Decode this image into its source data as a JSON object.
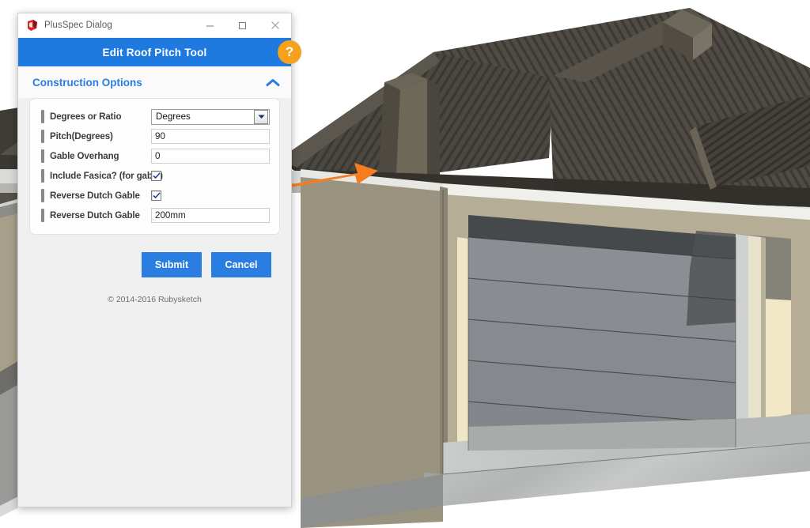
{
  "window": {
    "title": "PlusSpec Dialog",
    "app_icon": "sketchup-logo-icon",
    "controls": [
      {
        "name": "minimize-button",
        "glyph": "minimize-icon"
      },
      {
        "name": "maximize-button",
        "glyph": "maximize-icon"
      },
      {
        "name": "close-button",
        "glyph": "close-icon"
      }
    ]
  },
  "header": {
    "title": "Edit Roof Pitch Tool",
    "help_label": "?",
    "background_color": "#1f7ae0",
    "help_color": "#f5a11b"
  },
  "section": {
    "title": "Construction Options",
    "collapse_icon": "chevron-up-icon",
    "accent_color": "#2a7de1"
  },
  "form": {
    "fields": [
      {
        "label": "Degrees or Ratio",
        "type": "select",
        "value": "Degrees"
      },
      {
        "label": "Pitch(Degrees)",
        "type": "text",
        "value": "90"
      },
      {
        "label": "Gable Overhang",
        "type": "text",
        "value": "0"
      },
      {
        "label": "Include Fasica? (for gable)",
        "type": "checkbox",
        "value": "checked"
      },
      {
        "label": "Reverse Dutch Gable",
        "type": "checkbox",
        "value": "checked"
      },
      {
        "label": "Reverse Dutch Gable",
        "type": "text",
        "value": "200mm"
      }
    ]
  },
  "actions": {
    "submit_label": "Submit",
    "cancel_label": "Cancel"
  },
  "footer": {
    "copyright": "© 2014-2016 Rubysketch"
  },
  "scene": {
    "description": "3D model of a house corner with dark charcoal corrugated hip roof, taupe rendered walls, a grey sectional garage door and a concrete slab edge",
    "annotation": {
      "name": "pointer-arrow",
      "color": "#f57c1f",
      "points_to": "roof-eave-gable"
    },
    "colors": {
      "roof_dark": "#484540",
      "roof_mid": "#565249",
      "roof_light": "#6d685c",
      "wall_shaded": "#9a937f",
      "wall_lit": "#b5ad96",
      "jamb_cream": "#f2e8c8",
      "door_grey": "#8c8f93",
      "door_dark": "#4a4d50",
      "concrete": "#b9bcbb",
      "background": "#ffffff"
    }
  }
}
